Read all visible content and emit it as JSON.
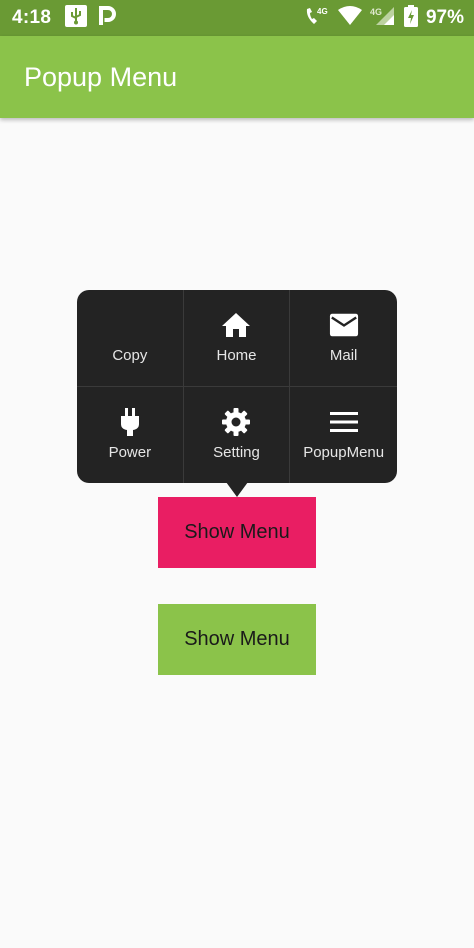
{
  "status_bar": {
    "time": "4:18",
    "battery_percent": "97%",
    "network_label": "4G",
    "icons": [
      "usb-icon",
      "parking-icon",
      "wifi-call-icon",
      "wifi-icon",
      "signal-icon",
      "battery-icon"
    ]
  },
  "app_bar": {
    "title": "Popup Menu",
    "color": "#8bc34a"
  },
  "popup_menu": {
    "background": "#232323",
    "items": [
      {
        "label": "Copy",
        "icon": "none"
      },
      {
        "label": "Home",
        "icon": "home-icon"
      },
      {
        "label": "Mail",
        "icon": "mail-icon"
      },
      {
        "label": "Power",
        "icon": "power-plug-icon"
      },
      {
        "label": "Setting",
        "icon": "gear-icon"
      },
      {
        "label": "PopupMenu",
        "icon": "menu-icon"
      }
    ]
  },
  "buttons": {
    "first": {
      "label": "Show Menu",
      "color": "#e91e63"
    },
    "second": {
      "label": "Show Menu",
      "color": "#8bc34a"
    }
  }
}
